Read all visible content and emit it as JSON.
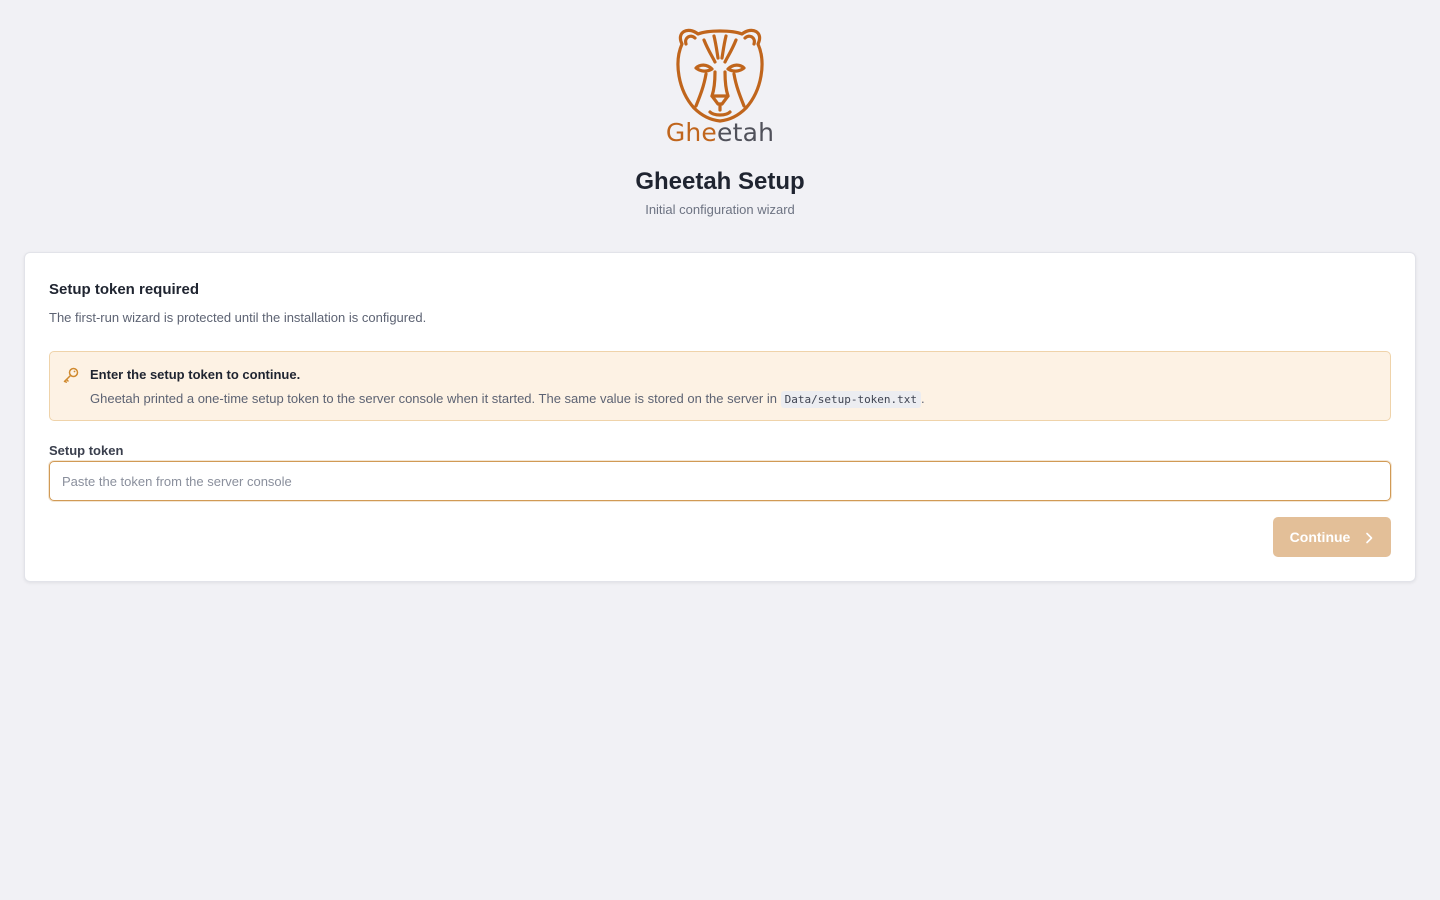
{
  "brand": {
    "logo_text_accent": "Ghe",
    "logo_text_rest": "etah",
    "accent_color": "#c0651c"
  },
  "header": {
    "title": "Gheetah Setup",
    "subtitle": "Initial configuration wizard"
  },
  "card": {
    "title": "Setup token required",
    "description": "The first-run wizard is protected until the installation is configured.",
    "notice": {
      "icon": "key-icon",
      "title": "Enter the setup token to continue.",
      "body_prefix": "Gheetah printed a one-time setup token to the server console when it started. The same value is stored on the server in ",
      "body_code": "Data/setup-token.txt",
      "body_suffix": "."
    },
    "field": {
      "label": "Setup token",
      "placeholder": "Paste the token from the server console",
      "value": ""
    },
    "continue_button": {
      "label": "Continue",
      "icon": "chevron-right-icon",
      "disabled": true
    }
  }
}
